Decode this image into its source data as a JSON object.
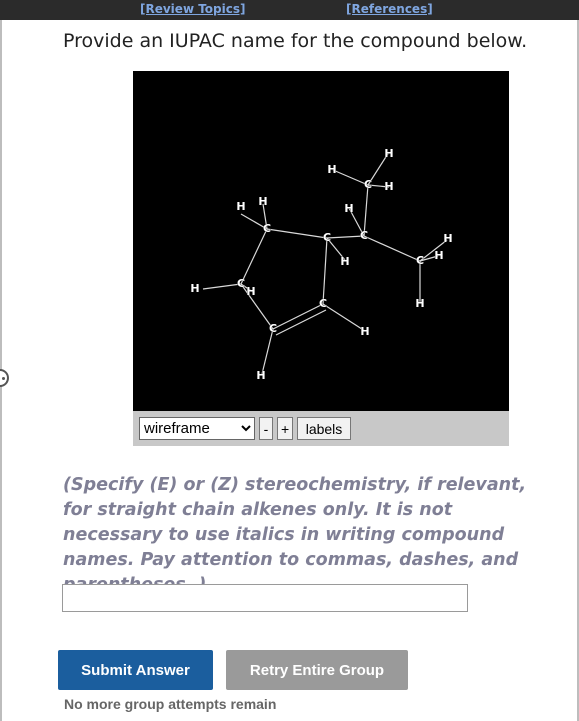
{
  "header": {
    "review_topics": "[Review Topics]",
    "references": "[References]"
  },
  "question": {
    "prompt": "Provide an IUPAC name for the compound below."
  },
  "viewer": {
    "atom_carbon": "C",
    "atom_hydrogen": "H",
    "mode_selected": "wireframe",
    "mode_options": [
      "wireframe"
    ],
    "minus_label": "-",
    "plus_label": "+",
    "labels_label": "labels"
  },
  "instructions": {
    "text": "(Specify (E) or (Z) stereochemistry, if relevant, for straight chain alkenes only. It is not necessary to use italics in writing compound names. Pay attention to commas, dashes, and parentheses. )"
  },
  "answer": {
    "value": "",
    "placeholder": ""
  },
  "buttons": {
    "submit": "Submit Answer",
    "retry": "Retry Entire Group"
  },
  "status": {
    "attempts": "No more group attempts remain"
  },
  "colors": {
    "topbar": "#2b2b2b",
    "link": "#7fa6e0",
    "submit": "#1b5e9e",
    "retry": "#9a9a9a",
    "instructions": "#7f7f95"
  }
}
